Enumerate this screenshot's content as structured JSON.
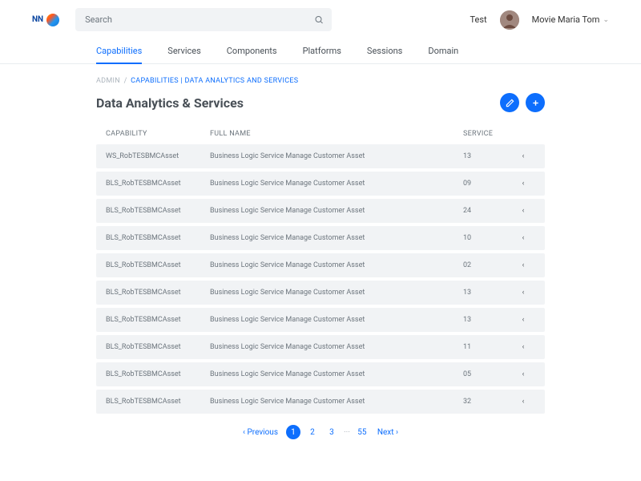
{
  "logo": {
    "text": "NN"
  },
  "search": {
    "placeholder": "Search"
  },
  "header": {
    "test_label": "Test",
    "user_name": "Movie Maria Tom"
  },
  "tabs": [
    {
      "label": "Capabilities",
      "active": true
    },
    {
      "label": "Services"
    },
    {
      "label": "Components"
    },
    {
      "label": "Platforms"
    },
    {
      "label": "Sessions"
    },
    {
      "label": "Domain"
    }
  ],
  "breadcrumb": {
    "root": "ADMIN",
    "sep": "/",
    "current": "CAPABILITIES | DATA ANALYTICS AND SERVICES"
  },
  "page_title": "Data Analytics & Services",
  "columns": {
    "capability": "CAPABILITY",
    "full_name": "FULL NAME",
    "service": "SERVICE"
  },
  "rows": [
    {
      "cap": "WS_RobTESBMCAsset",
      "full": "Business Logic Service Manage Customer Asset",
      "svc": "13"
    },
    {
      "cap": "BLS_RobTESBMCAsset",
      "full": "Business Logic Service Manage Customer Asset",
      "svc": "09"
    },
    {
      "cap": "BLS_RobTESBMCAsset",
      "full": "Business Logic Service Manage Customer Asset",
      "svc": "24"
    },
    {
      "cap": "BLS_RobTESBMCAsset",
      "full": "Business Logic Service Manage Customer Asset",
      "svc": "10"
    },
    {
      "cap": "BLS_RobTESBMCAsset",
      "full": "Business Logic Service Manage Customer Asset",
      "svc": "02"
    },
    {
      "cap": "BLS_RobTESBMCAsset",
      "full": "Business Logic Service Manage Customer Asset",
      "svc": "13"
    },
    {
      "cap": "BLS_RobTESBMCAsset",
      "full": "Business Logic Service Manage Customer Asset",
      "svc": "13"
    },
    {
      "cap": "BLS_RobTESBMCAsset",
      "full": "Business Logic Service Manage Customer Asset",
      "svc": "11"
    },
    {
      "cap": "BLS_RobTESBMCAsset",
      "full": "Business Logic Service Manage Customer Asset",
      "svc": "05"
    },
    {
      "cap": "BLS_RobTESBMCAsset",
      "full": "Business Logic Service Manage Customer Asset",
      "svc": "32"
    }
  ],
  "pagination": {
    "prev": "Previous",
    "pages": [
      "1",
      "2",
      "3"
    ],
    "dots": "···",
    "last": "55",
    "next": "Next",
    "active": "1"
  }
}
